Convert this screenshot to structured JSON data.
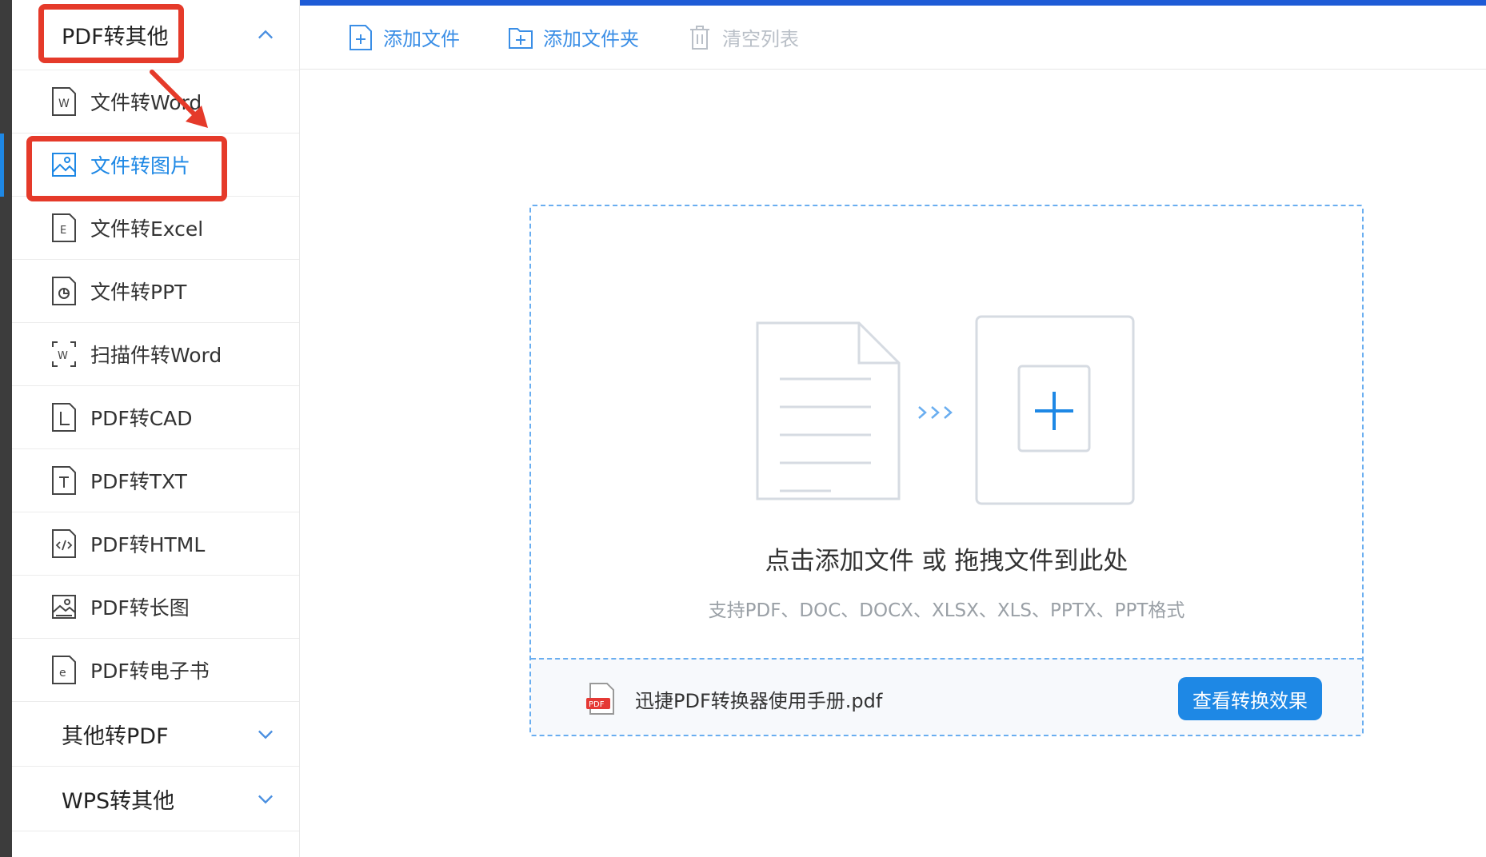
{
  "sidebar": {
    "group_pdf_to_other": "PDF转其他",
    "items": [
      {
        "label": "文件转Word",
        "icon": "word-doc-icon"
      },
      {
        "label": "文件转图片",
        "icon": "image-doc-icon"
      },
      {
        "label": "文件转Excel",
        "icon": "excel-doc-icon"
      },
      {
        "label": "文件转PPT",
        "icon": "ppt-doc-icon"
      },
      {
        "label": "扫描件转Word",
        "icon": "scan-word-icon"
      },
      {
        "label": "PDF转CAD",
        "icon": "cad-doc-icon"
      },
      {
        "label": "PDF转TXT",
        "icon": "txt-doc-icon"
      },
      {
        "label": "PDF转HTML",
        "icon": "html-doc-icon"
      },
      {
        "label": "PDF转长图",
        "icon": "long-image-icon"
      },
      {
        "label": "PDF转电子书",
        "icon": "ebook-doc-icon"
      }
    ],
    "group_other_to_pdf": "其他转PDF",
    "group_wps_to_other": "WPS转其他",
    "active_index": 1
  },
  "toolbar": {
    "add_file": "添加文件",
    "add_folder": "添加文件夹",
    "clear_list": "清空列表"
  },
  "dropzone": {
    "title": "点击添加文件 或 拖拽文件到此处",
    "subtitle": "支持PDF、DOC、DOCX、XLSX、XLS、PPTX、PPT格式",
    "file_name": "迅捷PDF转换器使用手册.pdf",
    "view_button": "查看转换效果"
  },
  "colors": {
    "accent": "#1e88e5",
    "annotation": "#e53a2a",
    "top_bar": "#1e5bd6"
  }
}
